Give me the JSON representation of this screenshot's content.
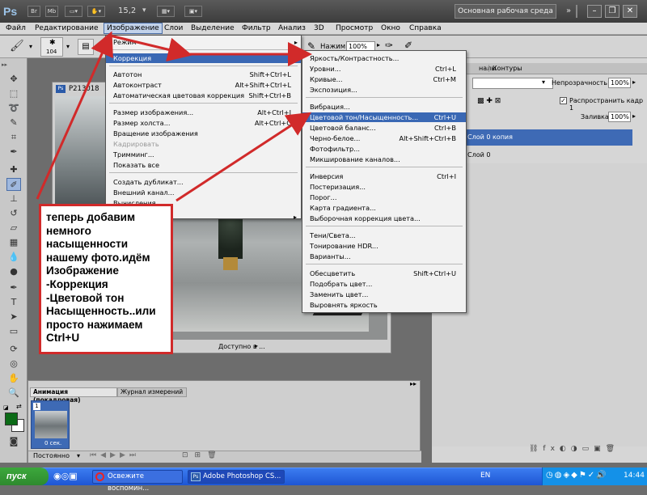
{
  "titlebar": {
    "logo": "Ps",
    "buttons": [
      "Br",
      "Mb"
    ],
    "zoom": "15,2",
    "workspace": "Основная рабочая среда"
  },
  "menubar": [
    "Файл",
    "Редактирование",
    "Изображение",
    "Слои",
    "Выделение",
    "Фильтр",
    "Анализ",
    "3D",
    "Просмотр",
    "Окно",
    "Справка"
  ],
  "options": {
    "brush_size": "104",
    "pressure_label": "Нажим:",
    "pressure_value": "100%"
  },
  "image_menu": {
    "items": [
      {
        "label": "Режим",
        "shortcut": "",
        "arrow": "▸"
      },
      {
        "label": "Коррекция",
        "shortcut": "",
        "arrow": "▸"
      },
      {
        "label": "Автотон",
        "shortcut": "Shift+Ctrl+L"
      },
      {
        "label": "Автоконтраст",
        "shortcut": "Alt+Shift+Ctrl+L"
      },
      {
        "label": "Автоматическая цветовая коррекция",
        "shortcut": "Shift+Ctrl+B"
      },
      {
        "label": "Размер изображения...",
        "shortcut": "Alt+Ctrl+I"
      },
      {
        "label": "Размер холста...",
        "shortcut": "Alt+Ctrl+C"
      },
      {
        "label": "Вращение изображения",
        "shortcut": ""
      },
      {
        "label": "Кадрировать",
        "shortcut": ""
      },
      {
        "label": "Тримминг...",
        "shortcut": ""
      },
      {
        "label": "Показать все",
        "shortcut": ""
      },
      {
        "label": "Создать дубликат...",
        "shortcut": ""
      },
      {
        "label": "Внешний канал...",
        "shortcut": ""
      },
      {
        "label": "Вычисления...",
        "shortcut": ""
      }
    ]
  },
  "correction_menu": {
    "items": [
      {
        "label": "Яркость/Контрастность...",
        "shortcut": ""
      },
      {
        "label": "Уровни...",
        "shortcut": "Ctrl+L"
      },
      {
        "label": "Кривые...",
        "shortcut": "Ctrl+M"
      },
      {
        "label": "Экспозиция...",
        "shortcut": ""
      },
      {
        "label": "Вибрация...",
        "shortcut": ""
      },
      {
        "label": "Цветовой тон/Насыщенность...",
        "shortcut": "Ctrl+U"
      },
      {
        "label": "Цветовой баланс...",
        "shortcut": "Ctrl+B"
      },
      {
        "label": "Черно-белое...",
        "shortcut": "Alt+Shift+Ctrl+B"
      },
      {
        "label": "Фотофильтр...",
        "shortcut": ""
      },
      {
        "label": "Микширование каналов...",
        "shortcut": ""
      },
      {
        "label": "Инверсия",
        "shortcut": "Ctrl+I"
      },
      {
        "label": "Постеризация...",
        "shortcut": ""
      },
      {
        "label": "Порог...",
        "shortcut": ""
      },
      {
        "label": "Карта градиента...",
        "shortcut": ""
      },
      {
        "label": "Выборочная коррекция цвета...",
        "shortcut": ""
      },
      {
        "label": "Тени/Света...",
        "shortcut": ""
      },
      {
        "label": "Тонирование HDR...",
        "shortcut": ""
      },
      {
        "label": "Варианты...",
        "shortcut": ""
      },
      {
        "label": "Обесцветить",
        "shortcut": "Shift+Ctrl+U"
      },
      {
        "label": "Подобрать цвет...",
        "shortcut": ""
      },
      {
        "label": "Заменить цвет...",
        "shortcut": ""
      },
      {
        "label": "Выровнять яркость",
        "shortcut": ""
      }
    ]
  },
  "document": {
    "title": "P213018",
    "status": "Доступно в ..."
  },
  "panels": {
    "tab_channels": "налы",
    "tab_paths": "Контуры",
    "opacity_label": "Непрозрачность:",
    "opacity_value": "100%",
    "propagate_label": "Распространить кадр 1",
    "fill_label": "Заливка:",
    "fill_value": "100%",
    "layers": [
      "Слой 0 копия",
      "Слой 0"
    ]
  },
  "animation": {
    "tab_animation": "Анимация (покадровая)",
    "tab_measure": "Журнал измерений",
    "frame_number": "1",
    "frame_time": "0 сек.",
    "loop": "Постоянно"
  },
  "note": {
    "text": "теперь добавим немного насыщенности нашему фото.идём Изображение -Коррекция -Цветовой тон Насыщенность..или просто нажимаем Ctrl+U"
  },
  "taskbar": {
    "start": "пуск",
    "tasks": [
      "Освежите воспомин...",
      "Adobe Photoshop CS..."
    ],
    "lang": "EN",
    "clock": "14:44"
  },
  "colors": {
    "highlight": "#3a68b4",
    "annotation": "#d12a2a"
  }
}
